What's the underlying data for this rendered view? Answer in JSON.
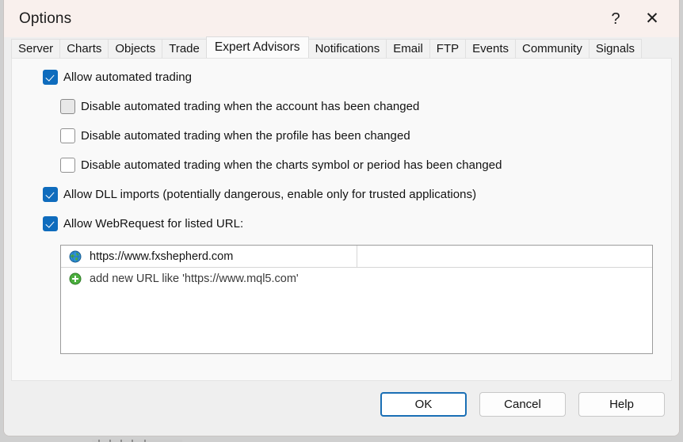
{
  "window": {
    "title": "Options",
    "help_icon": "?",
    "close_icon": "✕"
  },
  "tabs": [
    {
      "label": "Server",
      "active": false
    },
    {
      "label": "Charts",
      "active": false
    },
    {
      "label": "Objects",
      "active": false
    },
    {
      "label": "Trade",
      "active": false
    },
    {
      "label": "Expert Advisors",
      "active": true
    },
    {
      "label": "Notifications",
      "active": false
    },
    {
      "label": "Email",
      "active": false
    },
    {
      "label": "FTP",
      "active": false
    },
    {
      "label": "Events",
      "active": false
    },
    {
      "label": "Community",
      "active": false
    },
    {
      "label": "Signals",
      "active": false
    }
  ],
  "options": [
    {
      "label": "Allow automated trading",
      "checked": true,
      "indent": 0,
      "hover": false
    },
    {
      "label": "Disable automated trading when the account has been changed",
      "checked": false,
      "indent": 1,
      "hover": true
    },
    {
      "label": "Disable automated trading when the profile has been changed",
      "checked": false,
      "indent": 1,
      "hover": false
    },
    {
      "label": "Disable automated trading when the charts symbol or period has been changed",
      "checked": false,
      "indent": 1,
      "hover": false
    },
    {
      "label": "Allow DLL imports (potentially dangerous, enable only for trusted applications)",
      "checked": true,
      "indent": 0,
      "hover": false
    },
    {
      "label": "Allow WebRequest for listed URL:",
      "checked": true,
      "indent": 0,
      "hover": false
    }
  ],
  "url_list": {
    "entries": [
      {
        "icon": "globe-icon",
        "text": "https://www.fxshepherd.com"
      }
    ],
    "add_row": {
      "icon": "plus-icon",
      "text": "add new URL like 'https://www.mql5.com'"
    }
  },
  "buttons": {
    "ok": "OK",
    "cancel": "Cancel",
    "help": "Help"
  },
  "colors": {
    "titlebar": "#f9f0ed",
    "accent_checkbox": "#0f6cbd",
    "default_button_border": "#1a6fb5",
    "page_background": "#f9f9f9",
    "window_background": "#efefef"
  }
}
